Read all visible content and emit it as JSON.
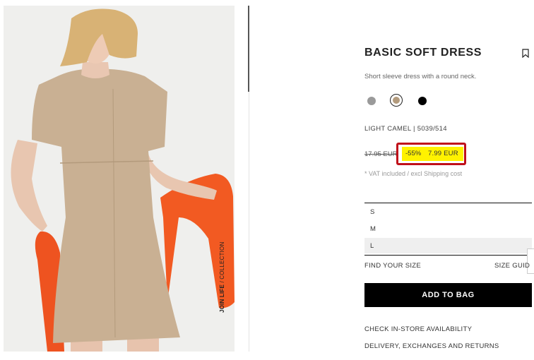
{
  "product": {
    "title": "BASIC SOFT DRESS",
    "description": "Short sleeve dress with a round neck.",
    "color_ref": "LIGHT CAMEL | 5039/514",
    "old_price": "17.95 EUR",
    "discount": "-55%",
    "new_price": "7.99 EUR",
    "vat_note": "* VAT included / excl Shipping cost"
  },
  "photo": {
    "vertical_text_bold": "JOIN LIFE",
    "vertical_text_rest": " / COLLECTION"
  },
  "colors": [
    {
      "name": "grey",
      "hex": "#9a9a9a"
    },
    {
      "name": "light camel",
      "hex": "#b39b7d",
      "selected": true
    },
    {
      "name": "black",
      "hex": "#000000"
    }
  ],
  "sizes": [
    {
      "label": "S"
    },
    {
      "label": "M"
    },
    {
      "label": "L",
      "selected": true
    }
  ],
  "links": {
    "find_size": "FIND YOUR SIZE",
    "size_guide": "SIZE GUID",
    "check_store": "CHECK IN-STORE AVAILABILITY",
    "delivery": "DELIVERY, EXCHANGES AND RETURNS"
  },
  "actions": {
    "add_to_bag": "ADD TO BAG"
  },
  "icons": {
    "bookmark": "bookmark-icon"
  },
  "accent": {
    "highlight": "#fff200",
    "box_border": "#c0101a"
  }
}
